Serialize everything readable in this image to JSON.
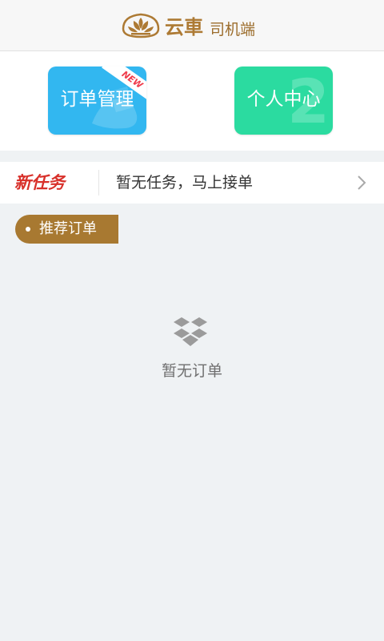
{
  "header": {
    "logo_icon": "lotus-logo-icon",
    "brand": "云車",
    "suffix": "司机端",
    "accent_color": "#ad7a34"
  },
  "tiles": [
    {
      "label": "订单管理",
      "badge": "NEW",
      "color": "#32b7f0",
      "icon": "order-hand-icon"
    },
    {
      "label": "个人中心",
      "decoration": "2",
      "color": "#2bdba0"
    }
  ],
  "task_row": {
    "tag": "新任务",
    "text": "暂无任务，马上接单",
    "icon": "chevron-right-icon",
    "tag_color": "#d8302a"
  },
  "recommend": {
    "label": "推荐订单",
    "color": "#a87931"
  },
  "empty_state": {
    "icon": "empty-box-icon",
    "text": "暂无订单"
  }
}
